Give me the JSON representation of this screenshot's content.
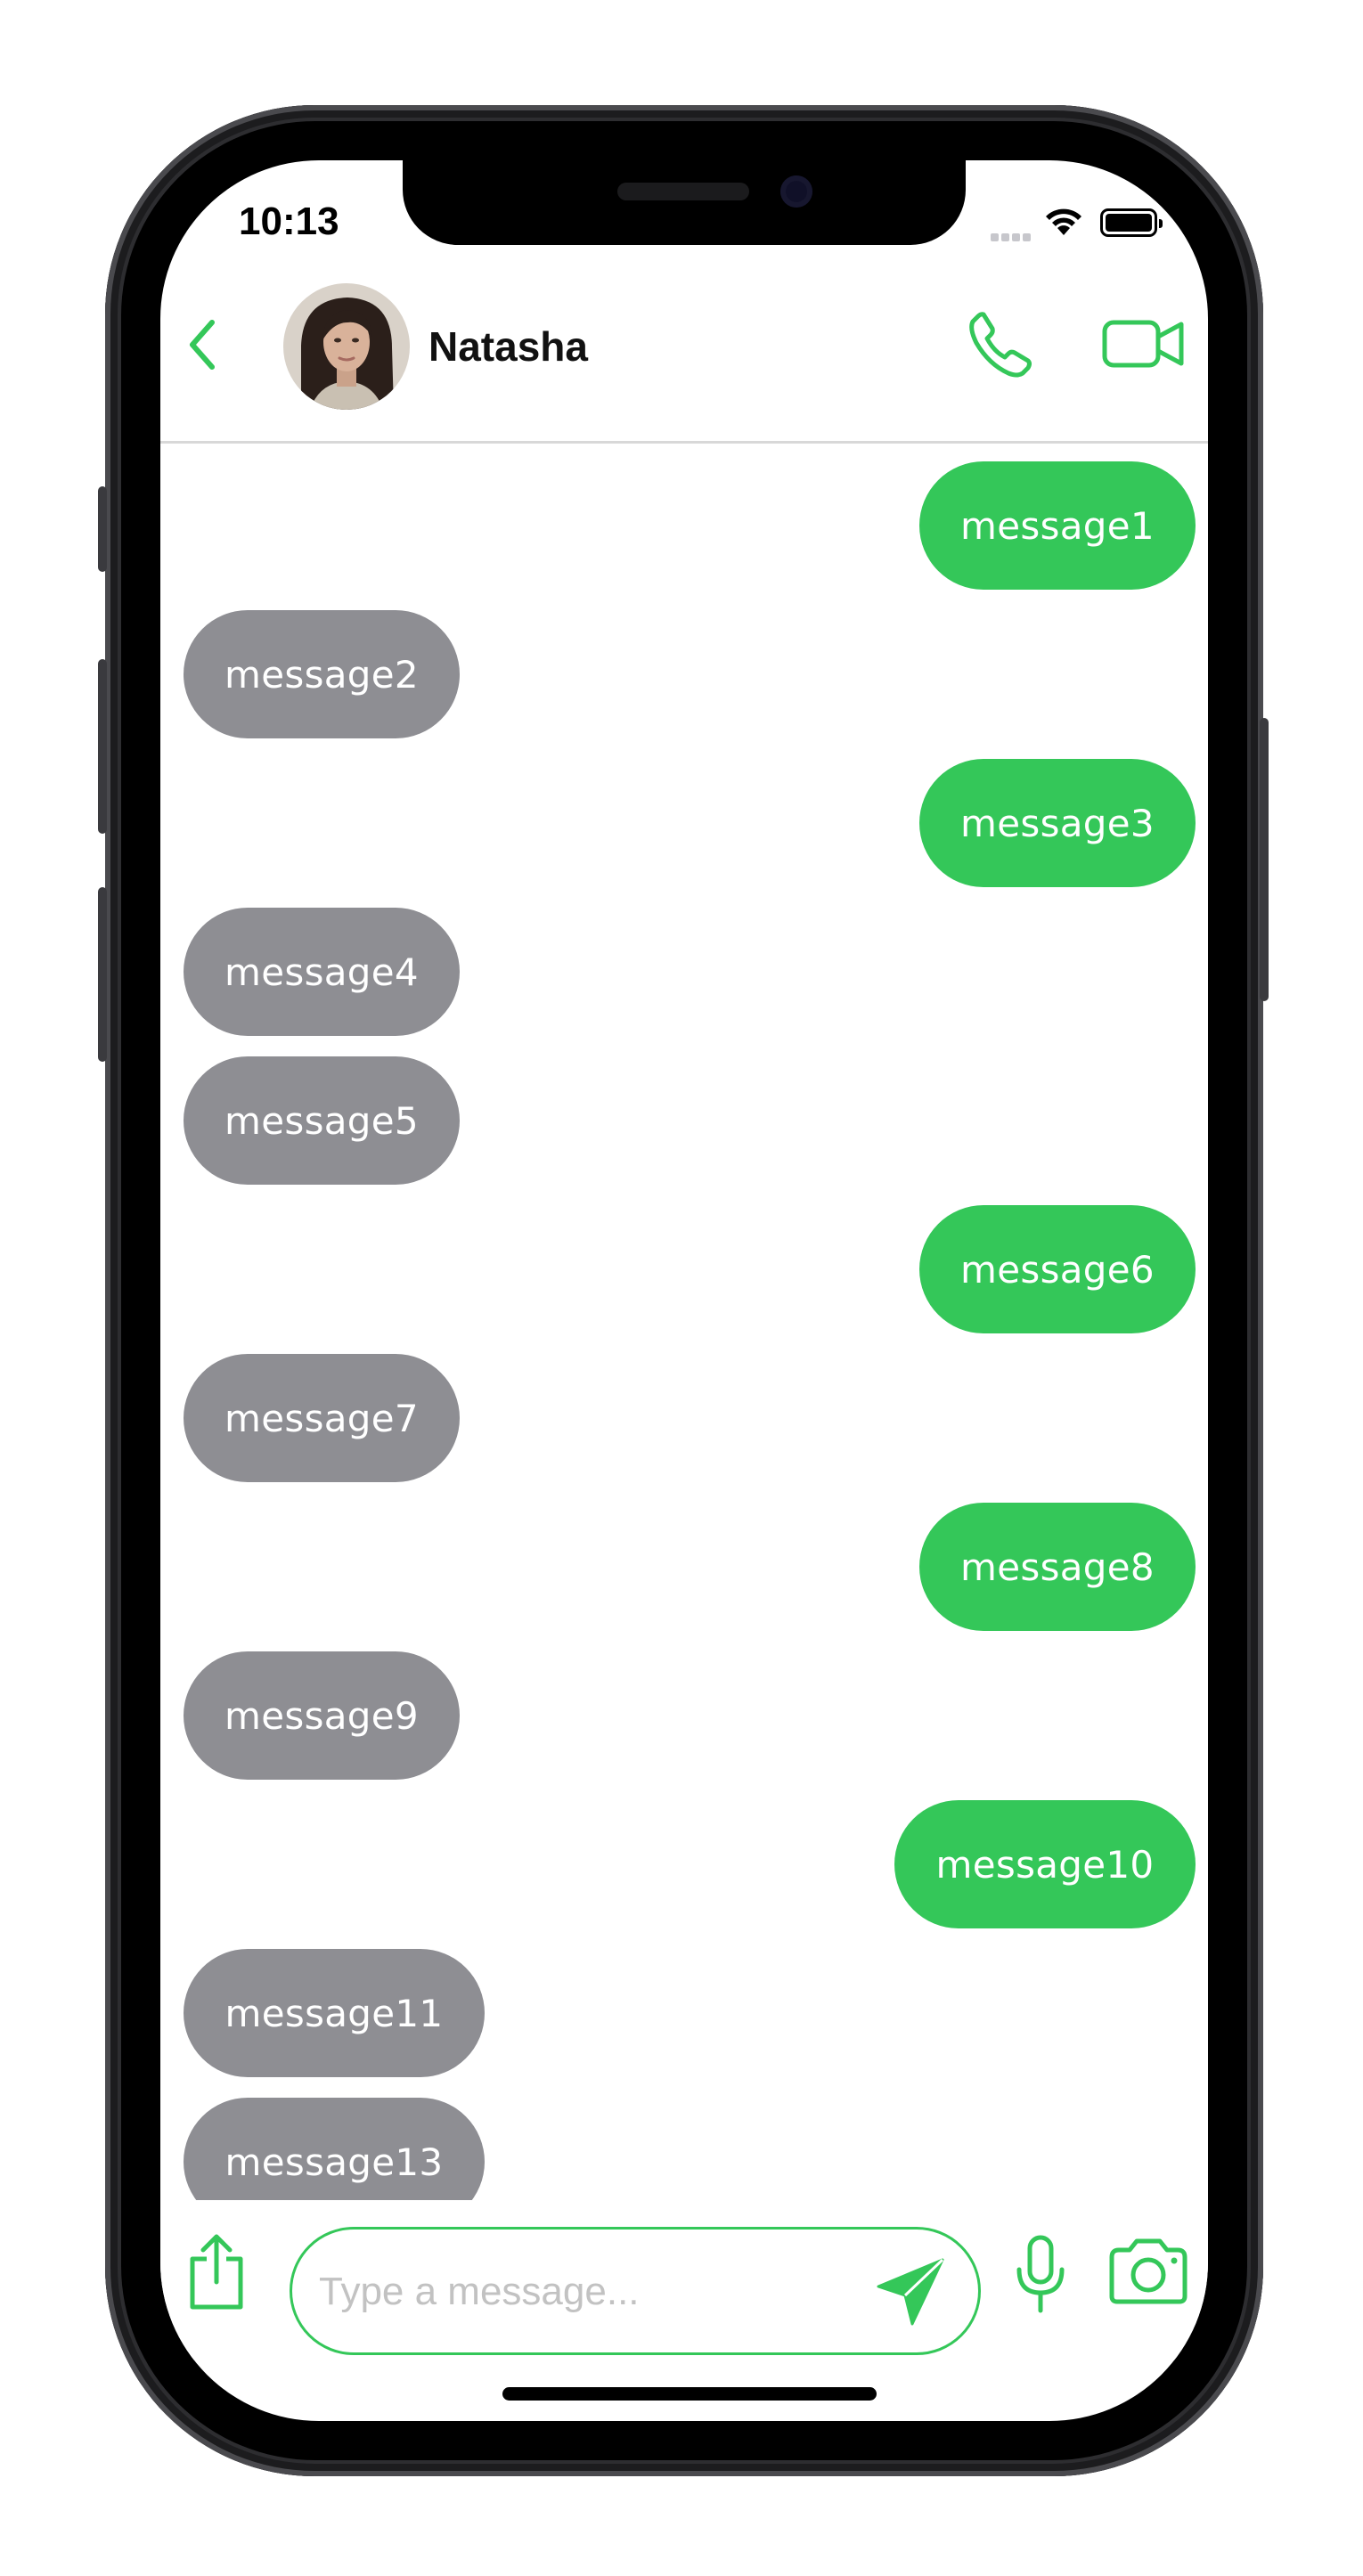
{
  "status_bar": {
    "time": "10:13"
  },
  "header": {
    "contact_name": "Natasha",
    "back_icon": "chevron-left-icon",
    "call_icon": "phone-icon",
    "video_icon": "video-camera-icon"
  },
  "messages": [
    {
      "text": "message1",
      "direction": "outgoing"
    },
    {
      "text": "message2",
      "direction": "incoming"
    },
    {
      "text": "message3",
      "direction": "outgoing"
    },
    {
      "text": "message4",
      "direction": "incoming"
    },
    {
      "text": "message5",
      "direction": "incoming"
    },
    {
      "text": "message6",
      "direction": "outgoing"
    },
    {
      "text": "message7",
      "direction": "incoming"
    },
    {
      "text": "message8",
      "direction": "outgoing"
    },
    {
      "text": "message9",
      "direction": "incoming"
    },
    {
      "text": "message10",
      "direction": "outgoing"
    },
    {
      "text": "message11",
      "direction": "incoming"
    },
    {
      "text": "message13",
      "direction": "incoming"
    }
  ],
  "composer": {
    "placeholder": "Type a message...",
    "value": "",
    "share_icon": "share-icon",
    "send_icon": "send-icon",
    "mic_icon": "microphone-icon",
    "camera_icon": "camera-icon"
  },
  "colors": {
    "accent": "#34c759",
    "outgoing_bubble": "#34c759",
    "incoming_bubble": "#8e8e93"
  }
}
